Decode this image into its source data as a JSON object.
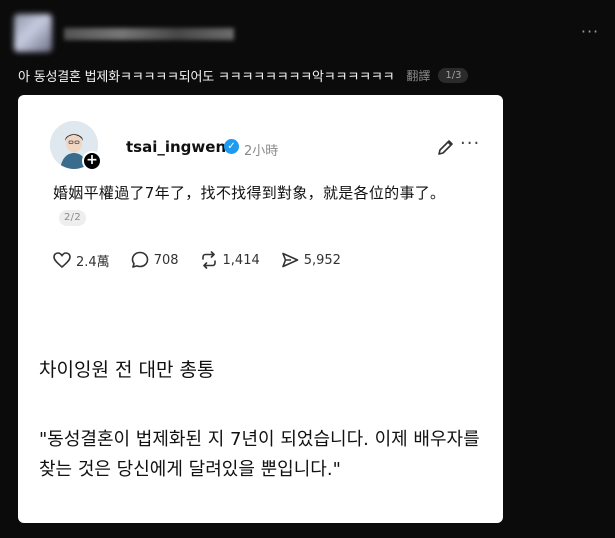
{
  "header": {
    "more_label": "···"
  },
  "caption": {
    "text": "아 동성결혼 법제화ㅋㅋㅋㅋㅋ되어도 ㅋㅋㅋㅋㅋㅋㅋㅋ악ㅋㅋㅋㅋㅋㅋ",
    "translate_label": "翻譯",
    "page_indicator": "1/3"
  },
  "embedded_post": {
    "username": "tsai_ingwen",
    "time": "2小時",
    "text": "婚姻平權過了7年了，找不找得到對象，就是各位的事了。",
    "page_indicator": "2/2",
    "more_label": "···",
    "stats": {
      "likes": "2.4萬",
      "comments": "708",
      "reposts": "1,414",
      "shares": "5,952"
    }
  },
  "translation": {
    "title": "차이잉원 전 대만 총통",
    "quote": "\"동성결혼이 법제화된 지 7년이 되었습니다. 이제 배우자를 찾는 것은 당신에게 달려있을 뿐입니다.\""
  },
  "colors": {
    "background": "#0b0b0b",
    "card": "#ffffff",
    "verified": "#1d9bf0"
  }
}
